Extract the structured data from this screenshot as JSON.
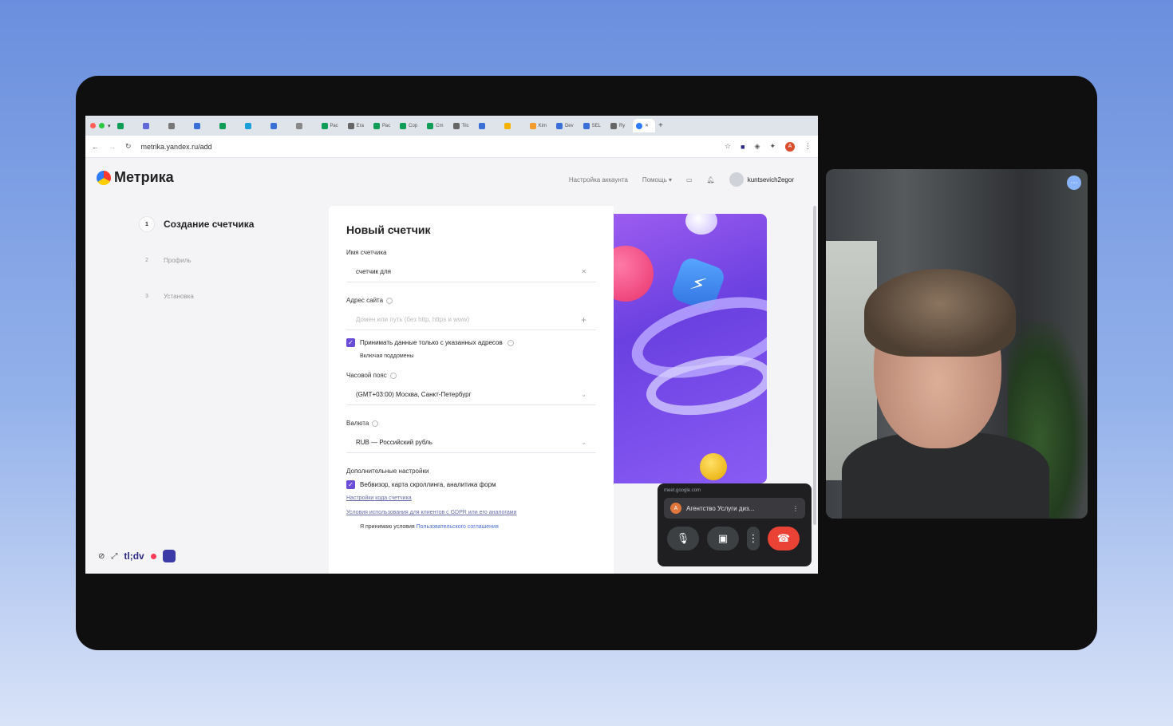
{
  "browser": {
    "url": "metrika.yandex.ru/add",
    "tabs": [
      "Рас",
      "Era",
      "Рас",
      "Сор",
      "Сm",
      "Tilc",
      "Kim",
      "Dev",
      "SEL",
      "Ry"
    ],
    "profile_initial": "A"
  },
  "metrika": {
    "logo": "Метрика",
    "nav": {
      "account_settings": "Настройка аккаунта",
      "help": "Помощь",
      "username": "kuntsevich2egor"
    },
    "steps": [
      {
        "num": "1",
        "label": "Создание счетчика"
      },
      {
        "num": "2",
        "label": "Профиль"
      },
      {
        "num": "3",
        "label": "Установка"
      }
    ],
    "form": {
      "title": "Новый счетчик",
      "name_label": "Имя счетчика",
      "name_value": "счетчик для",
      "site_label": "Адрес сайта",
      "site_placeholder": "Домен или путь (без http, https и www)",
      "accept_only_label": "Принимать данные только с указанных адресов",
      "subdomains": "Включая поддомены",
      "tz_label": "Часовой пояс",
      "tz_value": "(GMT+03:00) Москва, Санкт-Петербург",
      "currency_label": "Валюта",
      "currency_value": "RUB — Российский рубль",
      "extra_label": "Дополнительные настройки",
      "webvisor_label": "Вебвизор, карта скроллинга, аналитика форм",
      "code_settings_link": "Настройки кода счетчика",
      "gdpr_link": "Условия использования для клиентов с GDPR или его аналогами",
      "accept_terms": "Я принимаю условия",
      "user_agreement": "Пользовательского соглашения"
    }
  },
  "tldv": {
    "brand": "tl;dv"
  },
  "meet": {
    "url": "meet.google.com",
    "meeting_name": "Агентство Услуги диз...",
    "participant_initial": "A"
  }
}
